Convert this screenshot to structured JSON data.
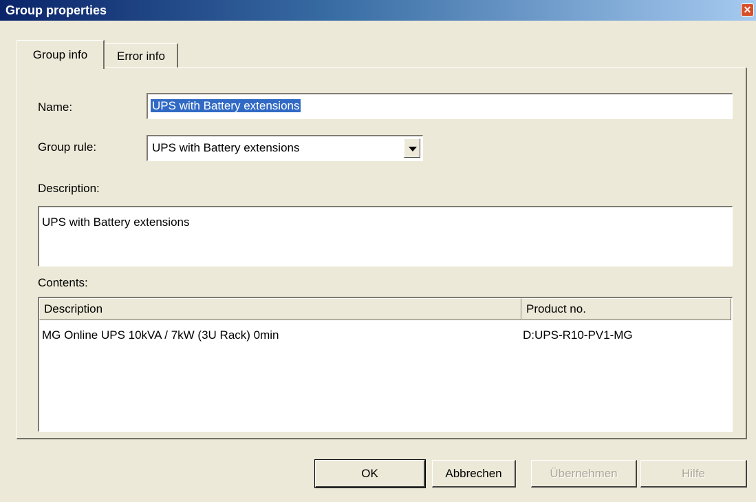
{
  "window": {
    "title": "Group properties"
  },
  "tabs": [
    {
      "label": "Group info",
      "active": true
    },
    {
      "label": "Error info",
      "active": false
    }
  ],
  "form": {
    "name_label": "Name:",
    "name_value": "UPS with Battery extensions",
    "group_rule_label": "Group rule:",
    "group_rule_value": "UPS with Battery extensions",
    "description_label": "Description:",
    "description_value": "UPS with Battery extensions",
    "contents_label": "Contents:"
  },
  "contents_table": {
    "columns": [
      "Description",
      "Product no."
    ],
    "rows": [
      {
        "description": "MG Online UPS 10kVA / 7kW (3U Rack) 0min",
        "product_no": "D:UPS-R10-PV1-MG"
      }
    ]
  },
  "buttons": {
    "ok": "OK",
    "cancel": "Abbrechen",
    "apply": "Übernehmen",
    "help": "Hilfe"
  },
  "icons": {
    "close": "close-icon",
    "dropdown": "chevron-down-icon"
  },
  "colors": {
    "titlebar": "#0a246a",
    "selection": "#316ac5",
    "face": "#ece9d8",
    "close": "#d8502a"
  }
}
